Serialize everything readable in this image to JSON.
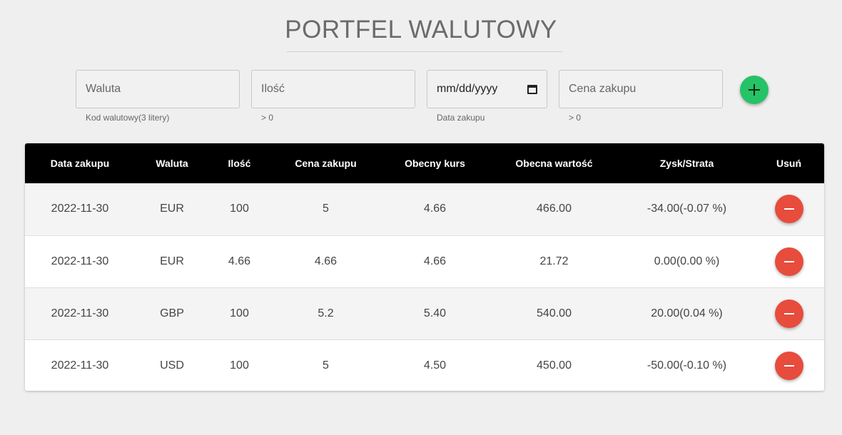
{
  "title": "PORTFEL WALUTOWY",
  "form": {
    "currency": {
      "placeholder": "Waluta",
      "helper": "Kod walutowy(3 litery)"
    },
    "quantity": {
      "placeholder": "Ilość",
      "helper": "> 0"
    },
    "date": {
      "value": "mm/dd/yyyy",
      "helper": "Data zakupu",
      "icon": "calendar-icon"
    },
    "price": {
      "placeholder": "Cena zakupu",
      "helper": "> 0"
    },
    "add_button": {
      "icon": "plus-icon",
      "color": "#26c267"
    }
  },
  "table": {
    "headers": [
      "Data zakupu",
      "Waluta",
      "Ilość",
      "Cena zakupu",
      "Obecny kurs",
      "Obecna wartość",
      "Zysk/Strata",
      "Usuń"
    ],
    "rows": [
      [
        "2022-11-30",
        "EUR",
        "100",
        "5",
        "4.66",
        "466.00",
        "-34.00(-0.07 %)"
      ],
      [
        "2022-11-30",
        "EUR",
        "4.66",
        "4.66",
        "4.66",
        "21.72",
        "0.00(0.00 %)"
      ],
      [
        "2022-11-30",
        "GBP",
        "100",
        "5.2",
        "5.40",
        "540.00",
        "20.00(0.04 %)"
      ],
      [
        "2022-11-30",
        "USD",
        "100",
        "5",
        "4.50",
        "450.00",
        "-50.00(-0.10 %)"
      ]
    ],
    "delete_button": {
      "icon": "minus-icon",
      "color": "#e74c3c"
    }
  }
}
